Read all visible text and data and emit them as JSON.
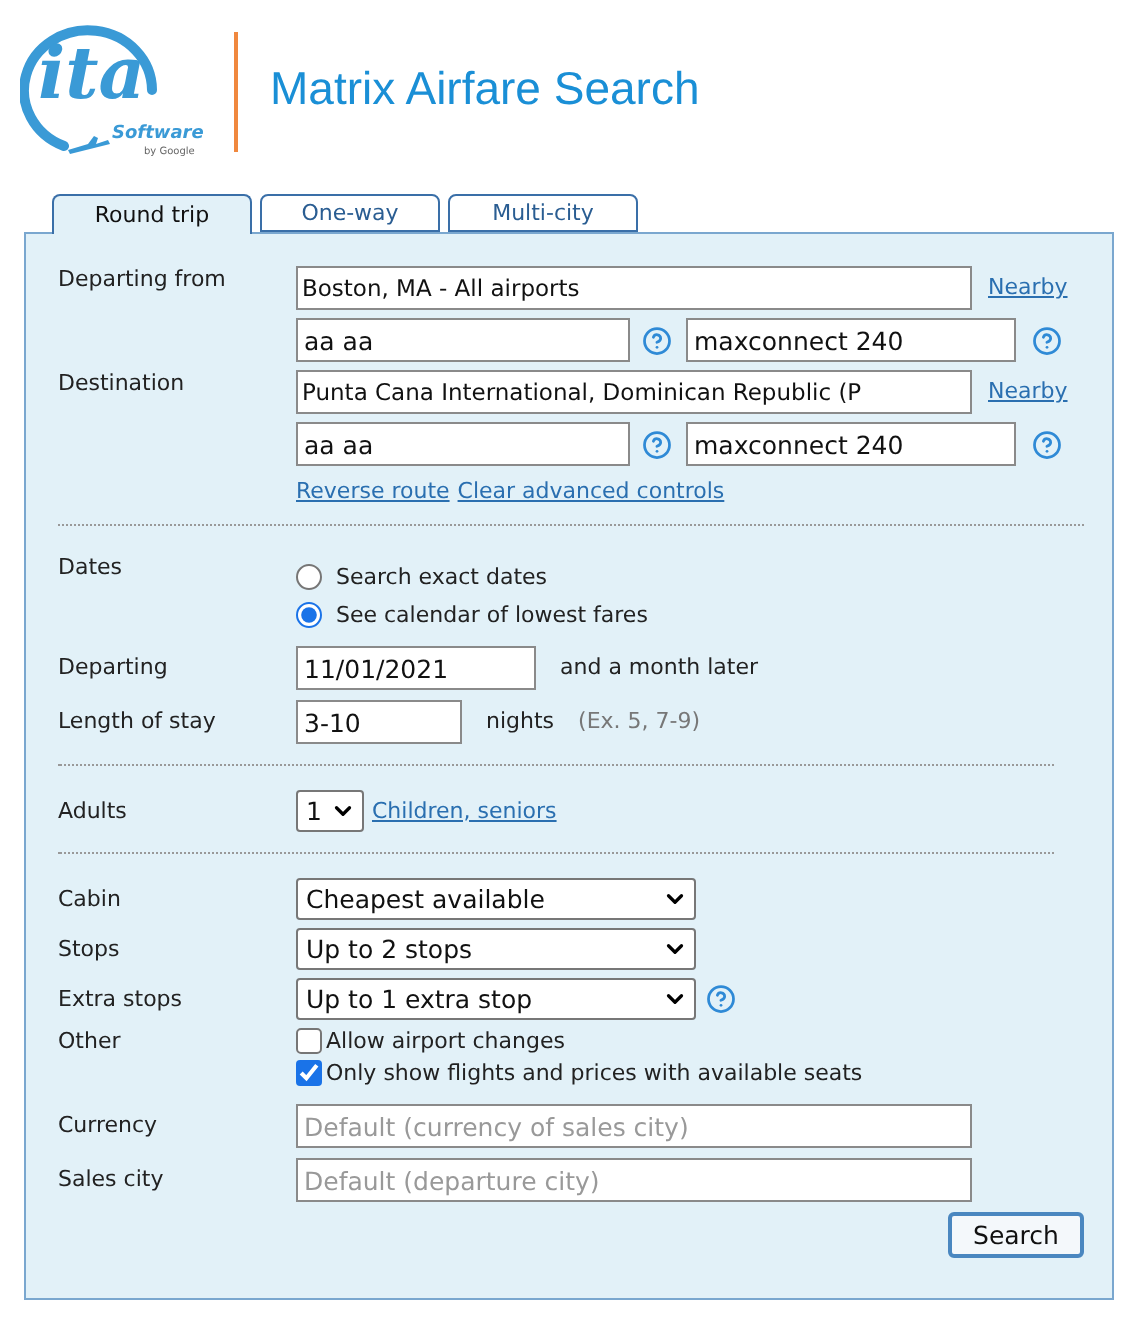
{
  "header": {
    "logo": {
      "wordmark": "ita",
      "sub": "Software",
      "byline": "by Google"
    },
    "title": "Matrix Airfare Search"
  },
  "tabs": [
    {
      "label": "Round trip",
      "selected": true
    },
    {
      "label": "One-way",
      "selected": false
    },
    {
      "label": "Multi-city",
      "selected": false
    }
  ],
  "route": [
    {
      "label": "Departing from",
      "city": "Boston, MA - All airports",
      "nearby": "Nearby",
      "routing": "aa aa",
      "extension": "maxconnect 240"
    },
    {
      "label": "Destination",
      "city": "Punta Cana International, Dominican Republic (P",
      "nearby": "Nearby",
      "routing": "aa aa",
      "extension": "maxconnect 240"
    }
  ],
  "route_links": [
    "Reverse route",
    "Clear advanced controls"
  ],
  "dates": {
    "label": "Dates",
    "options": [
      {
        "label": "Search exact dates",
        "selected": false
      },
      {
        "label": "See calendar of lowest fares",
        "selected": true
      }
    ]
  },
  "departing": {
    "label": "Departing",
    "value": "11/01/2021",
    "suffix": "and a month later"
  },
  "stay": {
    "label": "Length of stay",
    "value": "3-10",
    "unit": "nights",
    "hint": "(Ex. 5, 7-9)"
  },
  "adults": {
    "label": "Adults",
    "value": "1",
    "link": "Children, seniors"
  },
  "selects": [
    {
      "label": "Cabin",
      "value": "Cheapest available",
      "help": false
    },
    {
      "label": "Stops",
      "value": "Up to 2 stops",
      "help": false
    },
    {
      "label": "Extra stops",
      "value": "Up to 1 extra stop",
      "help": true
    }
  ],
  "other": {
    "label": "Other",
    "options": [
      {
        "label": "Allow airport changes",
        "checked": false
      },
      {
        "label": "Only show flights and prices with available seats",
        "checked": true
      }
    ]
  },
  "currency": {
    "label": "Currency",
    "placeholder": "Default (currency of sales city)"
  },
  "sales_city": {
    "label": "Sales city",
    "placeholder": "Default (departure city)"
  },
  "search_button": "Search"
}
